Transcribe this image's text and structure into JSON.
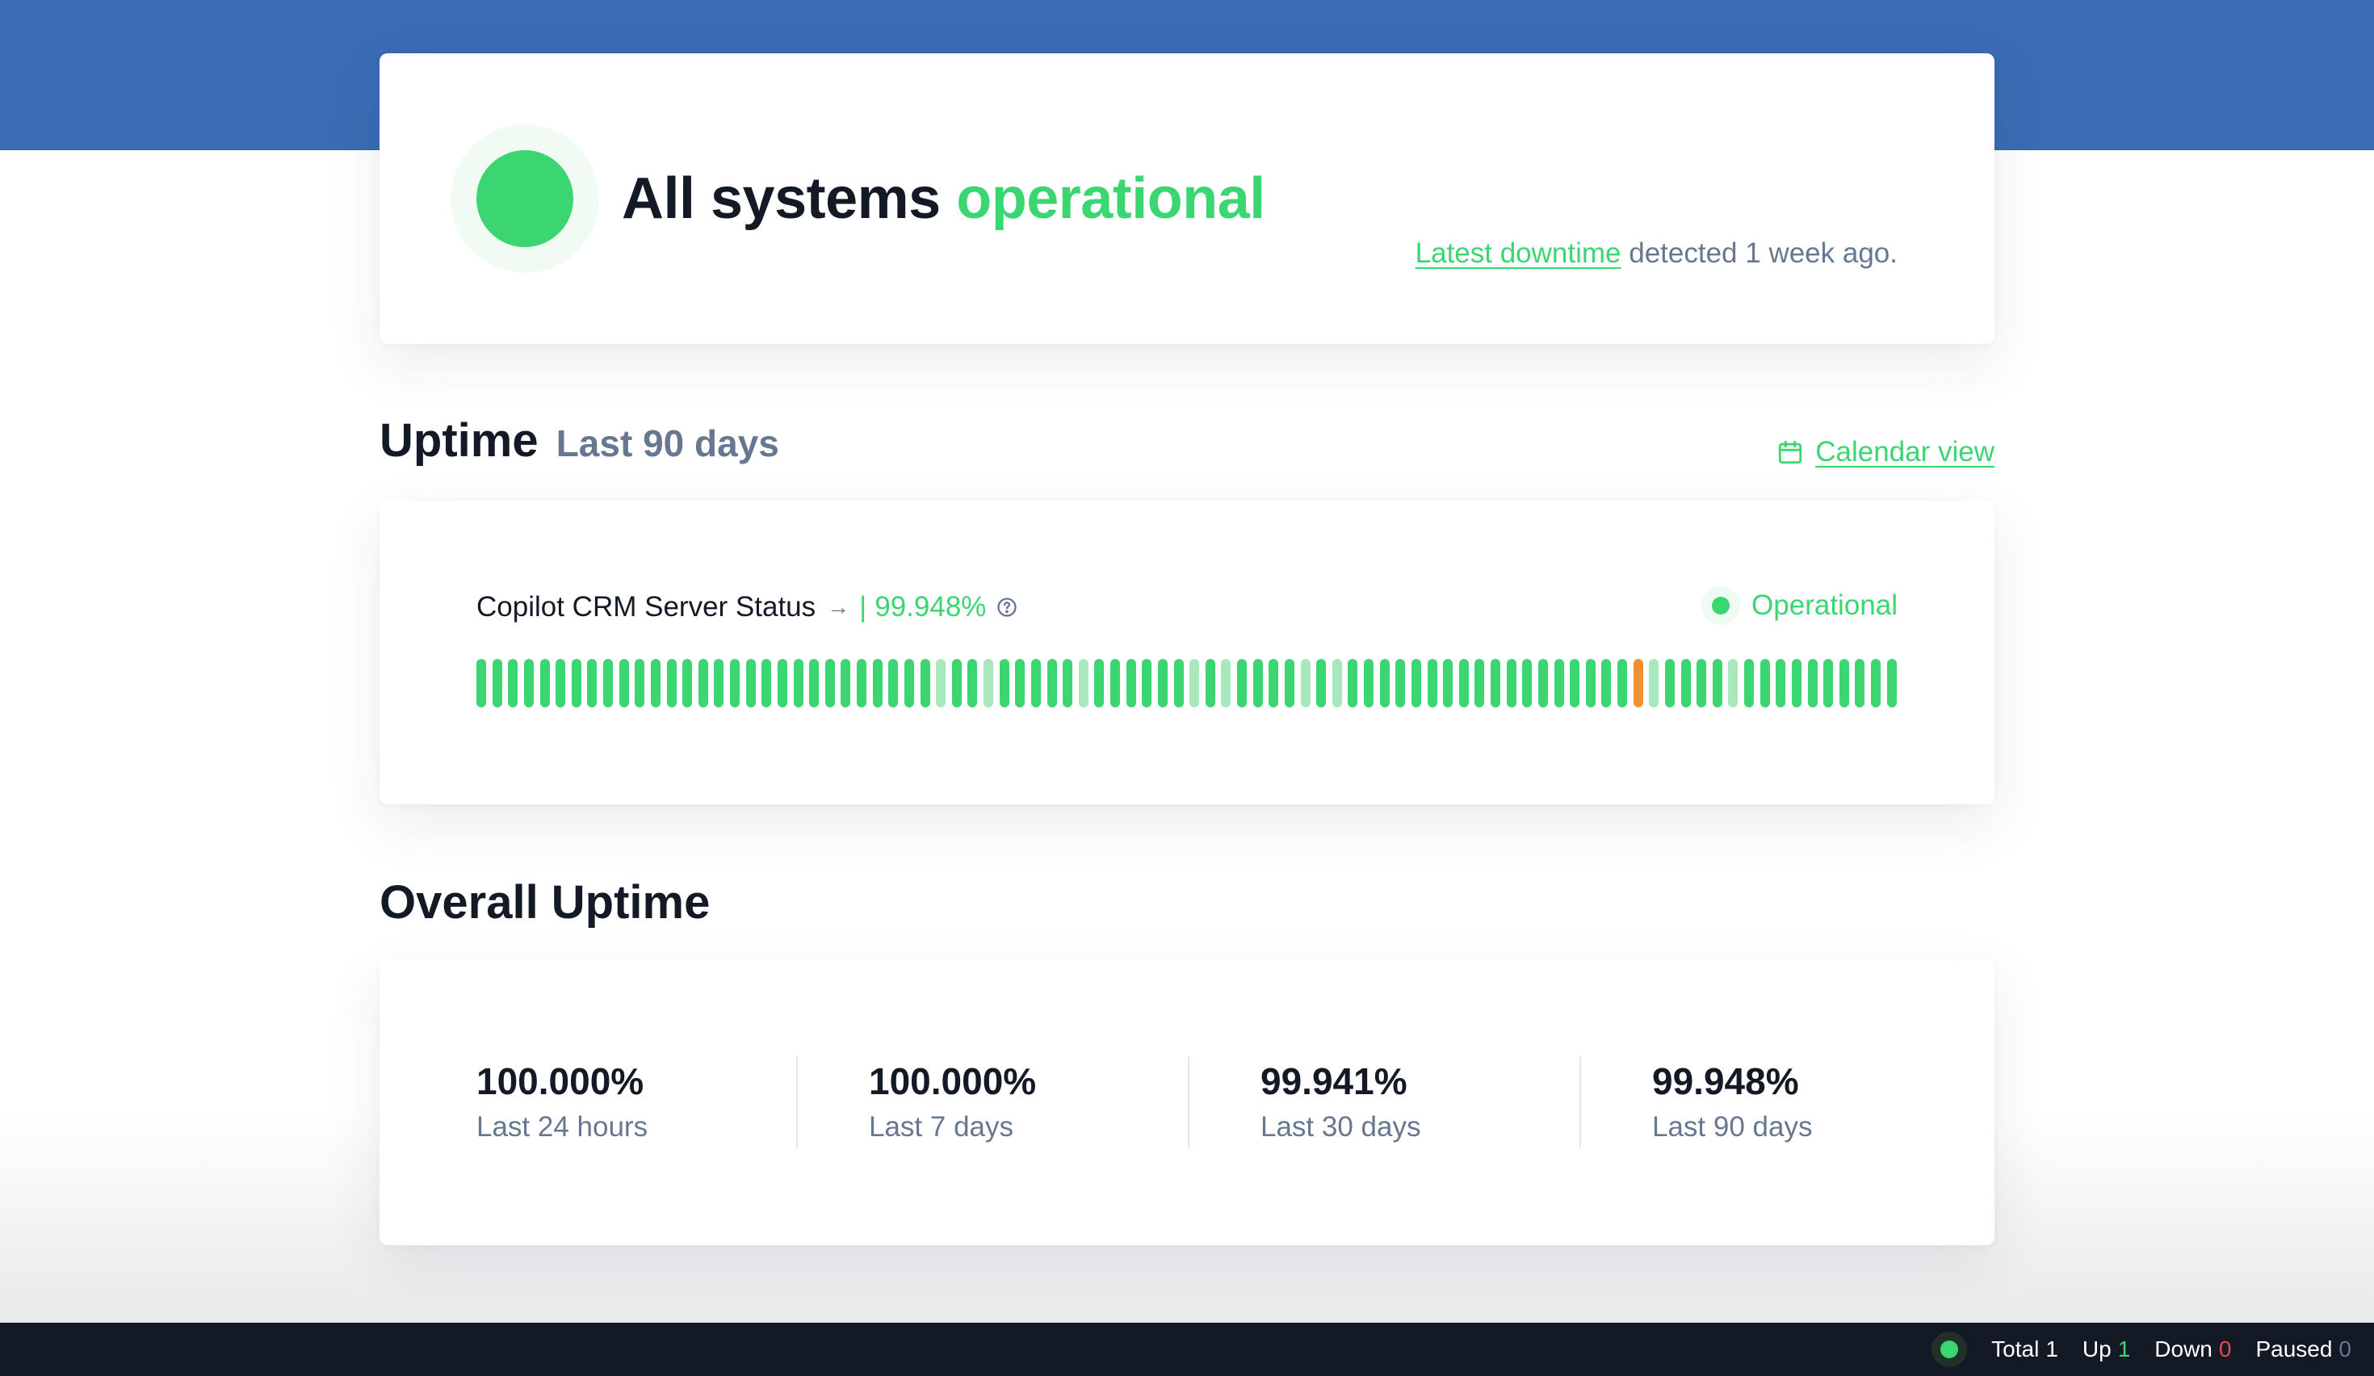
{
  "status": {
    "headline_prefix": "All systems",
    "headline_accent": "operational",
    "downtime_link": "Latest downtime",
    "downtime_suffix": "detected 1 week ago.",
    "accent_color": "#3bd671"
  },
  "uptime_section": {
    "title": "Uptime",
    "subtitle": "Last 90 days",
    "calendar_icon": "calendar-icon",
    "calendar_link": "Calendar view"
  },
  "monitor": {
    "name": "Copilot CRM Server Status",
    "arrow": "→",
    "separator": "|",
    "uptime": "99.948%",
    "help_icon": "question-circle-icon",
    "badge": "Operational",
    "days": [
      "up",
      "up",
      "up",
      "up",
      "up",
      "up",
      "up",
      "up",
      "up",
      "up",
      "up",
      "up",
      "up",
      "up",
      "up",
      "up",
      "up",
      "up",
      "up",
      "up",
      "up",
      "up",
      "up",
      "up",
      "up",
      "up",
      "up",
      "up",
      "up",
      "partial",
      "up",
      "up",
      "partial",
      "up",
      "up",
      "up",
      "up",
      "up",
      "partial",
      "up",
      "up",
      "up",
      "up",
      "up",
      "up",
      "partial",
      "up",
      "partial",
      "up",
      "up",
      "up",
      "up",
      "partial",
      "up",
      "partial",
      "up",
      "up",
      "up",
      "up",
      "up",
      "up",
      "up",
      "up",
      "up",
      "up",
      "up",
      "up",
      "up",
      "up",
      "up",
      "up",
      "up",
      "up",
      "down",
      "partial",
      "up",
      "up",
      "up",
      "up",
      "partial",
      "up",
      "up",
      "up",
      "up",
      "up",
      "up",
      "up",
      "up",
      "up",
      "up"
    ]
  },
  "overall_section": {
    "title": "Overall Uptime",
    "stats": [
      {
        "value": "100.000%",
        "label": "Last 24 hours"
      },
      {
        "value": "100.000%",
        "label": "Last 7 days"
      },
      {
        "value": "99.941%",
        "label": "Last 30 days"
      },
      {
        "value": "99.948%",
        "label": "Last 90 days"
      }
    ]
  },
  "footer": {
    "total_label": "Total",
    "total_value": "1",
    "up_label": "Up",
    "up_value": "1",
    "down_label": "Down",
    "down_value": "0",
    "paused_label": "Paused",
    "paused_value": "0"
  }
}
